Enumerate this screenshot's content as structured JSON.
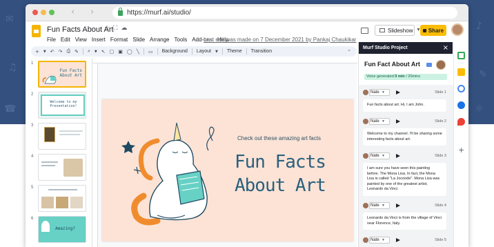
{
  "browser": {
    "url": "https://murf.ai/studio/",
    "back_icon": "chevron-left-icon",
    "forward_icon": "chevron-right-icon"
  },
  "app": {
    "doc_title": "Fun Facts About Art",
    "menus": [
      "File",
      "Edit",
      "View",
      "Insert",
      "Format",
      "Slide",
      "Arrange",
      "Tools",
      "Add-ons",
      "Help"
    ],
    "last_edit": "Last edit was made on 7 December 2021 by Pankaj Chaukikar",
    "slideshow_label": "Slideshow",
    "share_label": "Share"
  },
  "toolbar": {
    "background": "Background",
    "layout": "Layout",
    "theme": "Theme",
    "transition": "Transition"
  },
  "filmstrip": {
    "numbers": [
      "1",
      "2",
      "3",
      "4",
      "5",
      "6"
    ],
    "thumb1_title": "Fun Facts About Art",
    "thumb2_text": "Welcome to my Presentation!",
    "thumb6_text": "Amazing?"
  },
  "slide": {
    "subtitle": "Check out these amazing art facts",
    "title_line1": "Fun Facts",
    "title_line2": "About Art"
  },
  "murf": {
    "panel_title": "Murf Studio Project",
    "project_title": "Fun Fact About Art",
    "voice_generated_prefix": "Voice generated",
    "voice_generated_value": "0 min",
    "voice_generated_total": "/ 20mins",
    "blocks": [
      {
        "voice": "Nate",
        "slide": "Slide 1",
        "text": "Fun facts about art. Hi, I am John."
      },
      {
        "voice": "Nate",
        "slide": "Slide 2",
        "text": "Welcome to my channel. I'll be sharing some interesting facts about art."
      },
      {
        "voice": "Nate",
        "slide": "Slide 3",
        "text": "I am sure you have seen this painting before. The Mona Lisa. In fact, the Mona Lisa is called \"La Joconde\". Mona Lisa was painted by one of the greatest artist, Leonardo da Vinci."
      },
      {
        "voice": "Nate",
        "slide": "Slide 4",
        "text": "Leonardo da Vinci is from the village of Vinci near Florence, Italy."
      },
      {
        "voice": "Nate",
        "slide": "Slide 5",
        "text": ""
      }
    ]
  },
  "colors": {
    "accent": "#fbbc04",
    "slide_bg": "#fce3d6",
    "slide_text": "#2a607d",
    "murf_header": "#1f2330",
    "voice_badge": "#cbf2e2"
  }
}
